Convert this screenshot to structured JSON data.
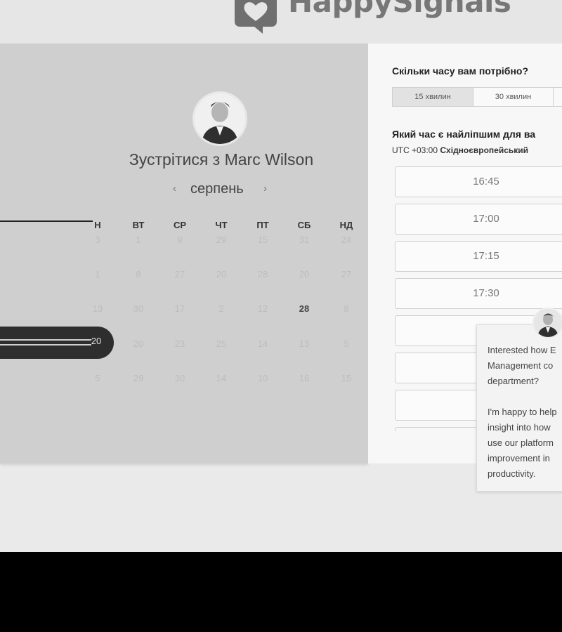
{
  "brand": {
    "name": "HappySignals"
  },
  "scheduler": {
    "meet_title": "Зустрітися з Marc Wilson",
    "month": "серпень",
    "weekdays": [
      "Н",
      "ВТ",
      "СР",
      "ЧТ",
      "ПТ",
      "СБ",
      "НД"
    ],
    "weeks": [
      [
        "3",
        "1",
        "9",
        "29",
        "15",
        "31",
        "24"
      ],
      [
        "1",
        "8",
        "27",
        "20",
        "28",
        "20",
        "27"
      ],
      [
        "13",
        "30",
        "17",
        "2",
        "12",
        "28",
        "8"
      ],
      [
        "20",
        "20",
        "23",
        "25",
        "14",
        "13",
        "5"
      ],
      [
        "5",
        "29",
        "30",
        "14",
        "10",
        "16",
        "15"
      ]
    ],
    "strong_day": "28"
  },
  "booking": {
    "duration_question": "Скільки часу вам потрібно?",
    "durations": [
      "15 хвилин",
      "30 хвилин"
    ],
    "time_question": "Який час є найліпшим для ва",
    "timezone_offset": "UTC +03:00",
    "timezone_name": "Східноєвропейський",
    "slots": [
      "16:45",
      "17:00",
      "17:15",
      "17:30",
      "",
      "",
      ""
    ]
  },
  "chat": {
    "lines": [
      "Interested how E",
      "Management co",
      "department?",
      "",
      "I'm happy to help",
      "insight into how",
      "use our platform",
      "improvement in",
      "productivity."
    ]
  },
  "colors": {
    "dark_select": "#2e2e2e",
    "panel_gray": "#cfcfcf",
    "logo_gray": "#777777"
  }
}
